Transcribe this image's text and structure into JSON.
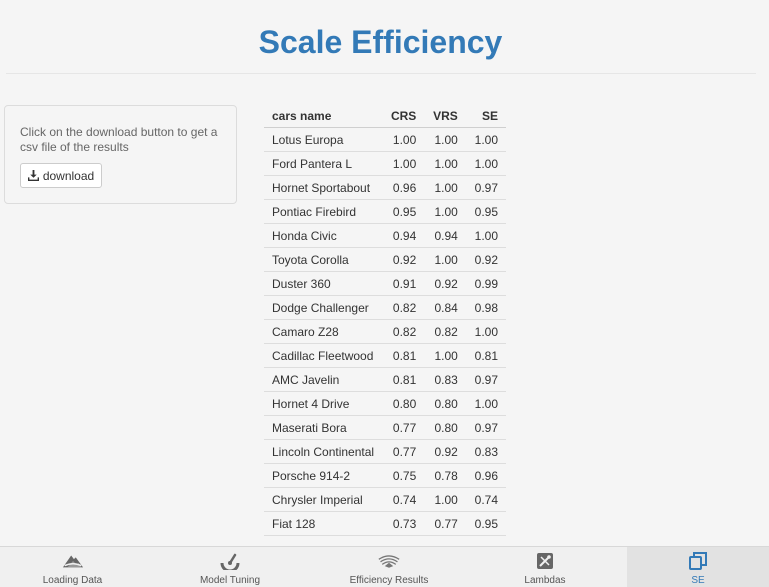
{
  "page": {
    "title": "Scale Efficiency"
  },
  "side_panel": {
    "help_text": "Click on the download button to get a csv file of the results",
    "download_label": "download"
  },
  "table": {
    "headers": [
      "cars name",
      "CRS",
      "VRS",
      "SE"
    ],
    "rows": [
      [
        "Lotus Europa",
        "1.00",
        "1.00",
        "1.00"
      ],
      [
        "Ford Pantera L",
        "1.00",
        "1.00",
        "1.00"
      ],
      [
        "Hornet Sportabout",
        "0.96",
        "1.00",
        "0.97"
      ],
      [
        "Pontiac Firebird",
        "0.95",
        "1.00",
        "0.95"
      ],
      [
        "Honda Civic",
        "0.94",
        "0.94",
        "1.00"
      ],
      [
        "Toyota Corolla",
        "0.92",
        "1.00",
        "0.92"
      ],
      [
        "Duster 360",
        "0.91",
        "0.92",
        "0.99"
      ],
      [
        "Dodge Challenger",
        "0.82",
        "0.84",
        "0.98"
      ],
      [
        "Camaro Z28",
        "0.82",
        "0.82",
        "1.00"
      ],
      [
        "Cadillac Fleetwood",
        "0.81",
        "1.00",
        "0.81"
      ],
      [
        "AMC Javelin",
        "0.81",
        "0.83",
        "0.97"
      ],
      [
        "Hornet 4 Drive",
        "0.80",
        "0.80",
        "1.00"
      ],
      [
        "Maserati Bora",
        "0.77",
        "0.80",
        "0.97"
      ],
      [
        "Lincoln Continental",
        "0.77",
        "0.92",
        "0.83"
      ],
      [
        "Porsche 914-2",
        "0.75",
        "0.78",
        "0.96"
      ],
      [
        "Chrysler Imperial",
        "0.74",
        "1.00",
        "0.74"
      ],
      [
        "Fiat 128",
        "0.73",
        "0.77",
        "0.95"
      ]
    ]
  },
  "tabs": [
    {
      "label": "Loading Data",
      "icon": "mountain-icon",
      "active": false
    },
    {
      "label": "Model Tuning",
      "icon": "gauge-icon",
      "active": false
    },
    {
      "label": "Efficiency Results",
      "icon": "layers-icon",
      "active": false
    },
    {
      "label": "Lambdas",
      "icon": "tools-icon",
      "active": false
    },
    {
      "label": "SE",
      "icon": "copy-icon",
      "active": true
    }
  ],
  "colors": {
    "accent": "#337ab7",
    "background": "#f5f5f5",
    "border": "#dddddd"
  }
}
